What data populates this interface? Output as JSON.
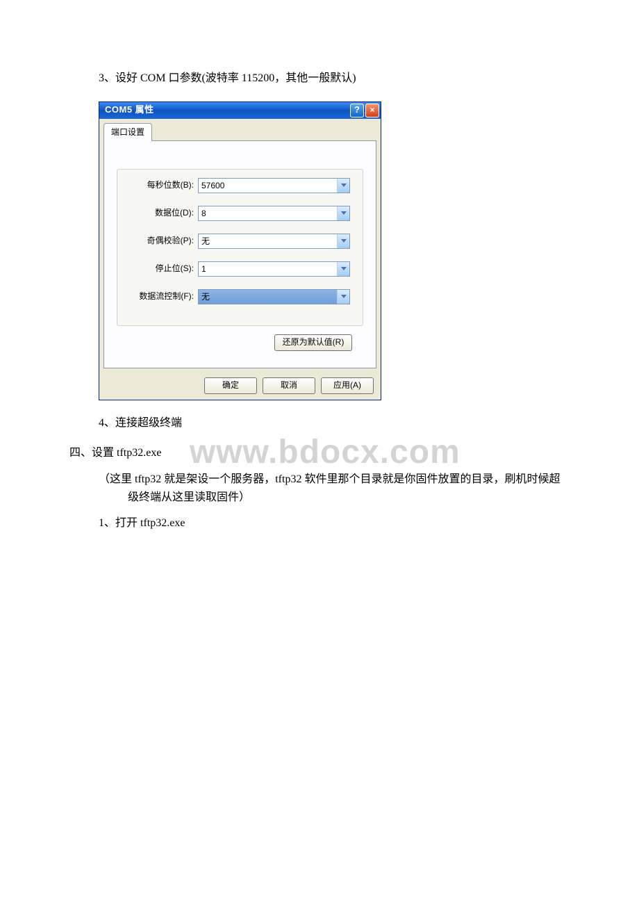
{
  "intro": {
    "line1": "3、设好 COM 口参数(波特率 115200，其他一般默认)"
  },
  "dialog": {
    "title": "COM5 属性",
    "tab": "端口设置",
    "fields": {
      "baud": {
        "label": "每秒位数(B):",
        "value": "57600"
      },
      "databits": {
        "label": "数据位(D):",
        "value": "8"
      },
      "parity": {
        "label": "奇偶校验(P):",
        "value": "无"
      },
      "stop": {
        "label": "停止位(S):",
        "value": "1"
      },
      "flow": {
        "label": "数据流控制(F):",
        "value": "无"
      }
    },
    "restore": "还原为默认值(R)",
    "buttons": {
      "ok": "确定",
      "cancel": "取消",
      "apply": "应用(A)"
    }
  },
  "post": {
    "line1": "4、连接超级终端",
    "section": "四、设置 tftp32.exe",
    "note1": "（这里 tftp32 就是架设一个服务器，tftp32 软件里那个目录就是你固件放置的目录，刷机时候超级终端从这里读取固件）",
    "line2": "1、打开 tftp32.exe"
  },
  "watermark": "www.bdocx.com"
}
